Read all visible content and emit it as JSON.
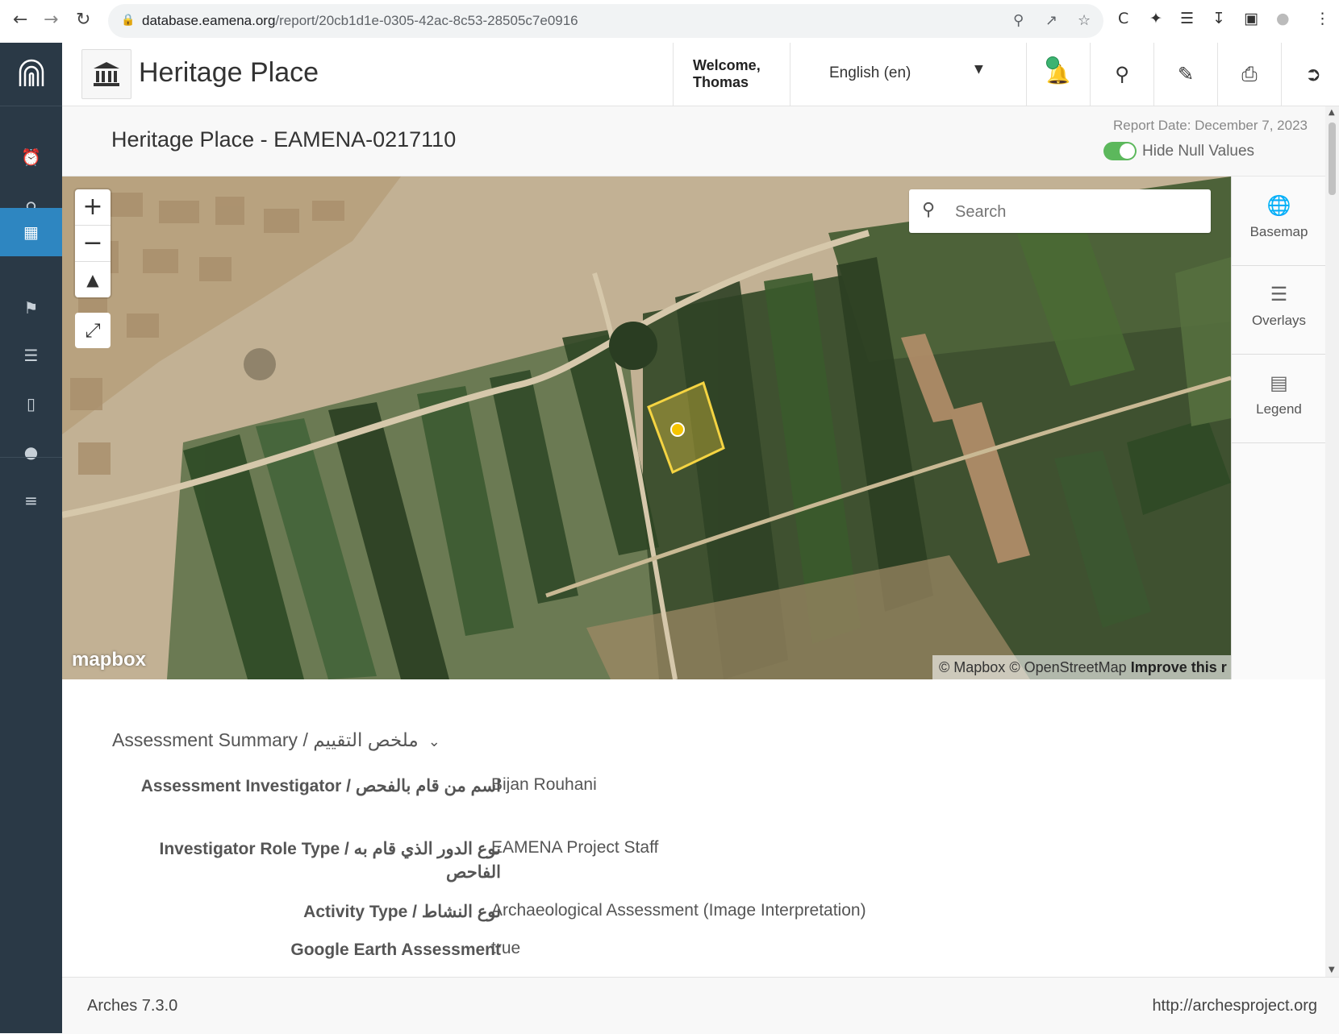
{
  "browser": {
    "url_host": "database.eamena.org",
    "url_path": "/report/20cb1d1e-0305-42ac-8c53-28505c7e0916"
  },
  "header": {
    "app_title": "Heritage Place",
    "welcome_line1": "Welcome,",
    "welcome_line2": "Thomas",
    "language": "English (en)"
  },
  "report": {
    "title": "Heritage Place - EAMENA-0217110",
    "report_date": "Report Date: December 7, 2023",
    "toggle_label": "Hide Null Values",
    "hide_null_values": true
  },
  "map": {
    "search_placeholder": "Search",
    "mapbox_logo": "mapbox",
    "attribution_mapbox": "© Mapbox",
    "attribution_osm": "© OpenStreetMap",
    "attribution_improve": "Improve this r",
    "panel": [
      {
        "label": "Basemap",
        "icon": "globe-icon"
      },
      {
        "label": "Overlays",
        "icon": "list-icon"
      },
      {
        "label": "Legend",
        "icon": "legend-icon"
      }
    ]
  },
  "assessment": {
    "section_title": "Assessment Summary / ملخص التقييم",
    "rows": [
      {
        "label": "Assessment Investigator / اسم من قام بالفحص",
        "value": "Bijan Rouhani"
      },
      {
        "label": "Investigator Role Type / نوع الدور الذي قام به الفاحص",
        "value": "EAMENA Project Staff"
      },
      {
        "label": "Activity Type / نوع النشاط",
        "value": "Archaeological Assessment (Image Interpretation)"
      },
      {
        "label": "Google Earth Assessment",
        "value": "true"
      }
    ]
  },
  "footer": {
    "version": "Arches 7.3.0",
    "link": "http://archesproject.org"
  },
  "colors": {
    "sidebar_bg": "#2a3946",
    "sidebar_active": "#2e86c1",
    "toggle_on": "#5cb85c",
    "feature_outline": "#f5d442"
  }
}
